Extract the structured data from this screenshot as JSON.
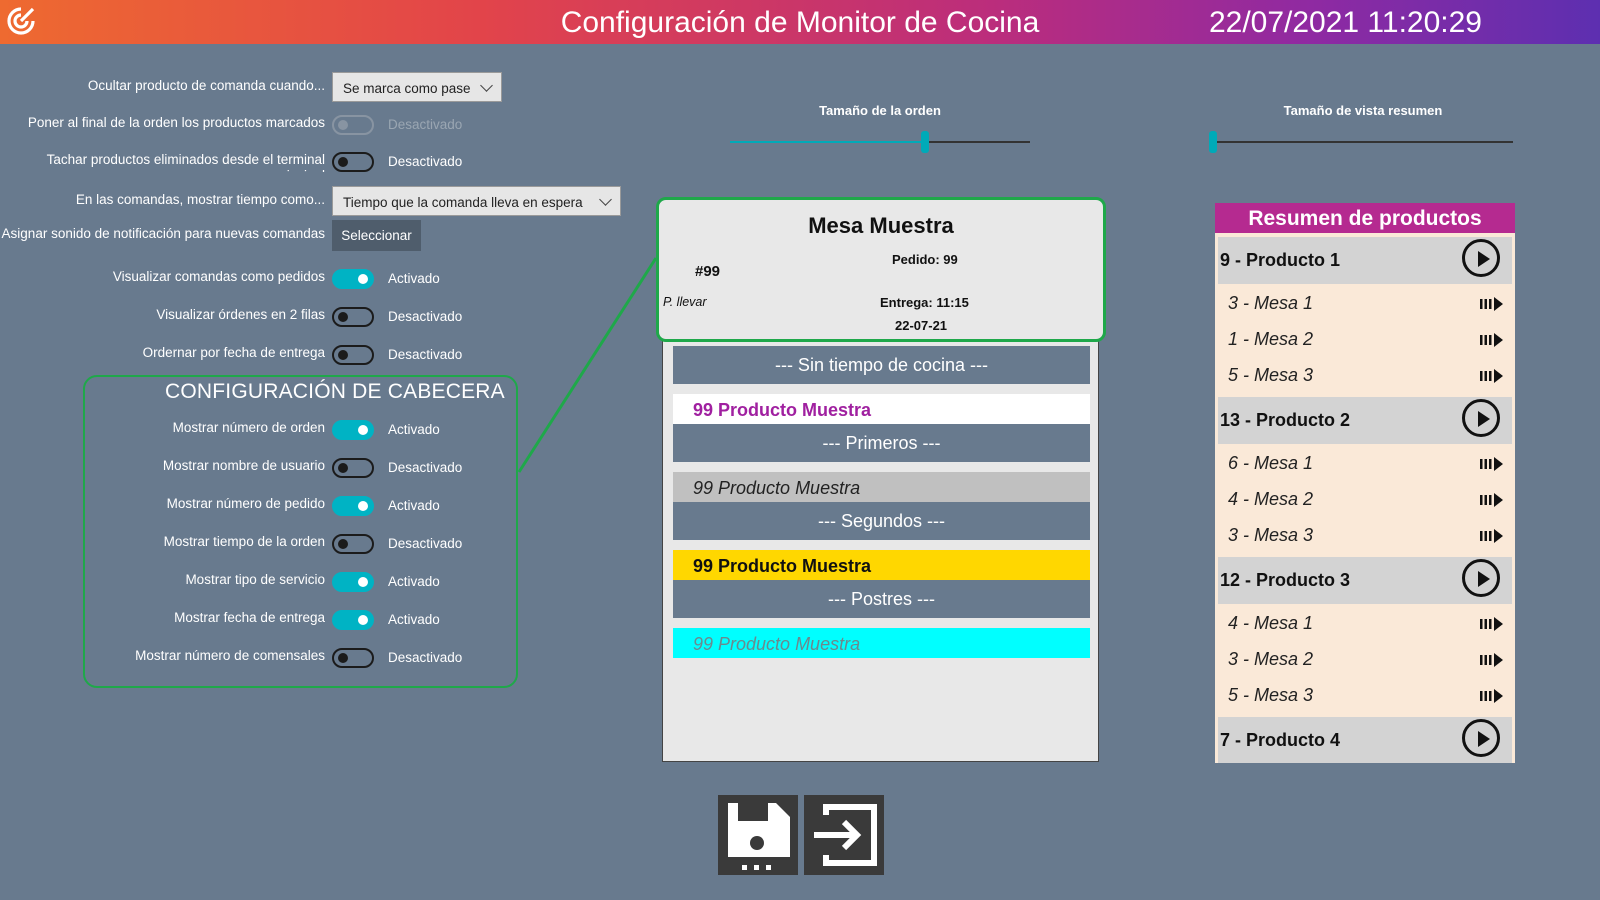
{
  "header": {
    "title": "Configuración de Monitor de Cocina",
    "datetime": "22/07/2021 11:20:29",
    "logo_icon": "app-logo-icon"
  },
  "settings": {
    "hide_product": {
      "label": "Ocultar producto de comanda cuando...",
      "value": "Se marca como pase"
    },
    "move_passed": {
      "label": "Poner al final de la orden los productos marcados como pase",
      "state": "Desactivado",
      "on": false,
      "disabled": true
    },
    "strike_deleted": {
      "label": "Tachar productos eliminados desde el terminal principal",
      "state": "Desactivado",
      "on": false
    },
    "show_time": {
      "label": "En las comandas, mostrar tiempo como...",
      "value": "Tiempo que la comanda lleva en espera"
    },
    "notification_sound": {
      "label": "Asignar sonido de notificación para nuevas comandas",
      "button": "Seleccionar"
    },
    "as_orders": {
      "label": "Visualizar comandas como pedidos",
      "state": "Activado",
      "on": true
    },
    "two_rows": {
      "label": "Visualizar órdenes en 2 filas",
      "state": "Desactivado",
      "on": false
    },
    "sort_delivery": {
      "label": "Ordernar por fecha de entrega",
      "state": "Desactivado",
      "on": false
    }
  },
  "header_config": {
    "title": "CONFIGURACIÓN DE CABECERA",
    "items": [
      {
        "label": "Mostrar número de orden",
        "state": "Activado",
        "on": true
      },
      {
        "label": "Mostrar nombre de usuario",
        "state": "Desactivado",
        "on": false
      },
      {
        "label": "Mostrar número de pedido",
        "state": "Activado",
        "on": true
      },
      {
        "label": "Mostrar tiempo de la orden",
        "state": "Desactivado",
        "on": false
      },
      {
        "label": "Mostrar tipo de servicio",
        "state": "Activado",
        "on": true
      },
      {
        "label": "Mostrar fecha de entrega",
        "state": "Activado",
        "on": true
      },
      {
        "label": "Mostrar número de comensales",
        "state": "Desactivado",
        "on": false
      }
    ]
  },
  "sliders": {
    "order_size": {
      "label": "Tamaño de la orden",
      "fraction": 0.65
    },
    "summary_size": {
      "label": "Tamaño de vista resumen",
      "fraction": 0.0
    }
  },
  "order": {
    "table": "Mesa Muestra",
    "pedido": "Pedido: 99",
    "number": "#99",
    "service": "P. llevar",
    "delivery": "Entrega: 11:15",
    "date": "22-07-21",
    "sections": [
      {
        "title": "--- Sin tiempo de cocina ---"
      },
      {
        "title": "--- Primeros ---"
      },
      {
        "title": "--- Segundos ---"
      },
      {
        "title": "--- Postres ---"
      }
    ],
    "products": [
      {
        "text": "99 Producto Muestra",
        "color": "#a020a0",
        "bg": "#ffffff"
      },
      {
        "text": "99 Producto Muestra",
        "color": "#222222",
        "bg": "#c0c0c0"
      },
      {
        "text": "99 Producto Muestra",
        "color": "#111111",
        "bg": "#ffd700"
      },
      {
        "text": "99 Producto Muestra",
        "color": "#6a8a8e",
        "bg": "#00ffff"
      }
    ]
  },
  "summary": {
    "title": "Resumen de productos",
    "products": [
      {
        "name": "9 - Producto 1",
        "tables": [
          "3 - Mesa 1",
          "1 - Mesa 2",
          "5 - Mesa 3"
        ]
      },
      {
        "name": "13 - Producto 2",
        "tables": [
          "6 - Mesa 1",
          "4 - Mesa 2",
          "3 - Mesa 3"
        ]
      },
      {
        "name": "12 - Producto 3",
        "tables": [
          "4 - Mesa 1",
          "3 - Mesa 2",
          "5 - Mesa 3"
        ]
      },
      {
        "name": "7 - Producto 4",
        "tables": []
      }
    ]
  },
  "buttons": {
    "save_icon": "save-icon",
    "exit_icon": "exit-icon"
  },
  "colors": {
    "background": "#687a8e",
    "accent": "#00b3c4",
    "group_border": "#1fa84a",
    "summary_title": "#b52a90"
  }
}
